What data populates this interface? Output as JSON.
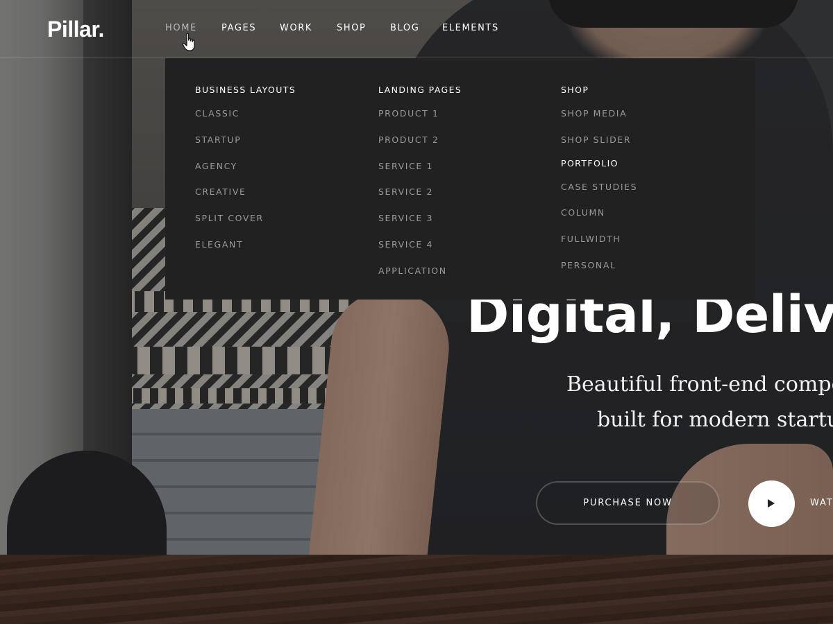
{
  "brand": {
    "logo_text": "Pillar."
  },
  "nav": {
    "items": [
      {
        "label": "HOME",
        "active": true
      },
      {
        "label": "PAGES"
      },
      {
        "label": "WORK"
      },
      {
        "label": "SHOP"
      },
      {
        "label": "BLOG"
      },
      {
        "label": "ELEMENTS"
      }
    ]
  },
  "mega_menu": {
    "columns": [
      {
        "heading": "BUSINESS LAYOUTS",
        "links": [
          "CLASSIC",
          "STARTUP",
          "AGENCY",
          "CREATIVE",
          "SPLIT COVER",
          "ELEGANT"
        ]
      },
      {
        "heading": "LANDING PAGES",
        "links": [
          "PRODUCT 1",
          "PRODUCT 2",
          "SERVICE 1",
          "SERVICE 2",
          "SERVICE 3",
          "SERVICE 4",
          "APPLICATION"
        ]
      },
      {
        "heading": "SHOP",
        "links": [
          "SHOP MEDIA",
          "SHOP SLIDER"
        ],
        "subheading": "PORTFOLIO",
        "sublinks": [
          "CASE STUDIES",
          "COLUMN",
          "FULLWIDTH",
          "PERSONAL"
        ]
      }
    ]
  },
  "hero": {
    "title": "Digital, Deliv",
    "subtitle_line1": "Beautiful front-end compon",
    "subtitle_line2": "built for modern startup",
    "purchase_label": "PURCHASE NOW",
    "watch_label": "WAT",
    "play_icon": "play-icon"
  },
  "colors": {
    "menu_background": "#212122",
    "menu_link": "#9a9a9a",
    "nav_active": "#b9b9b9",
    "text_primary": "#ffffff"
  }
}
